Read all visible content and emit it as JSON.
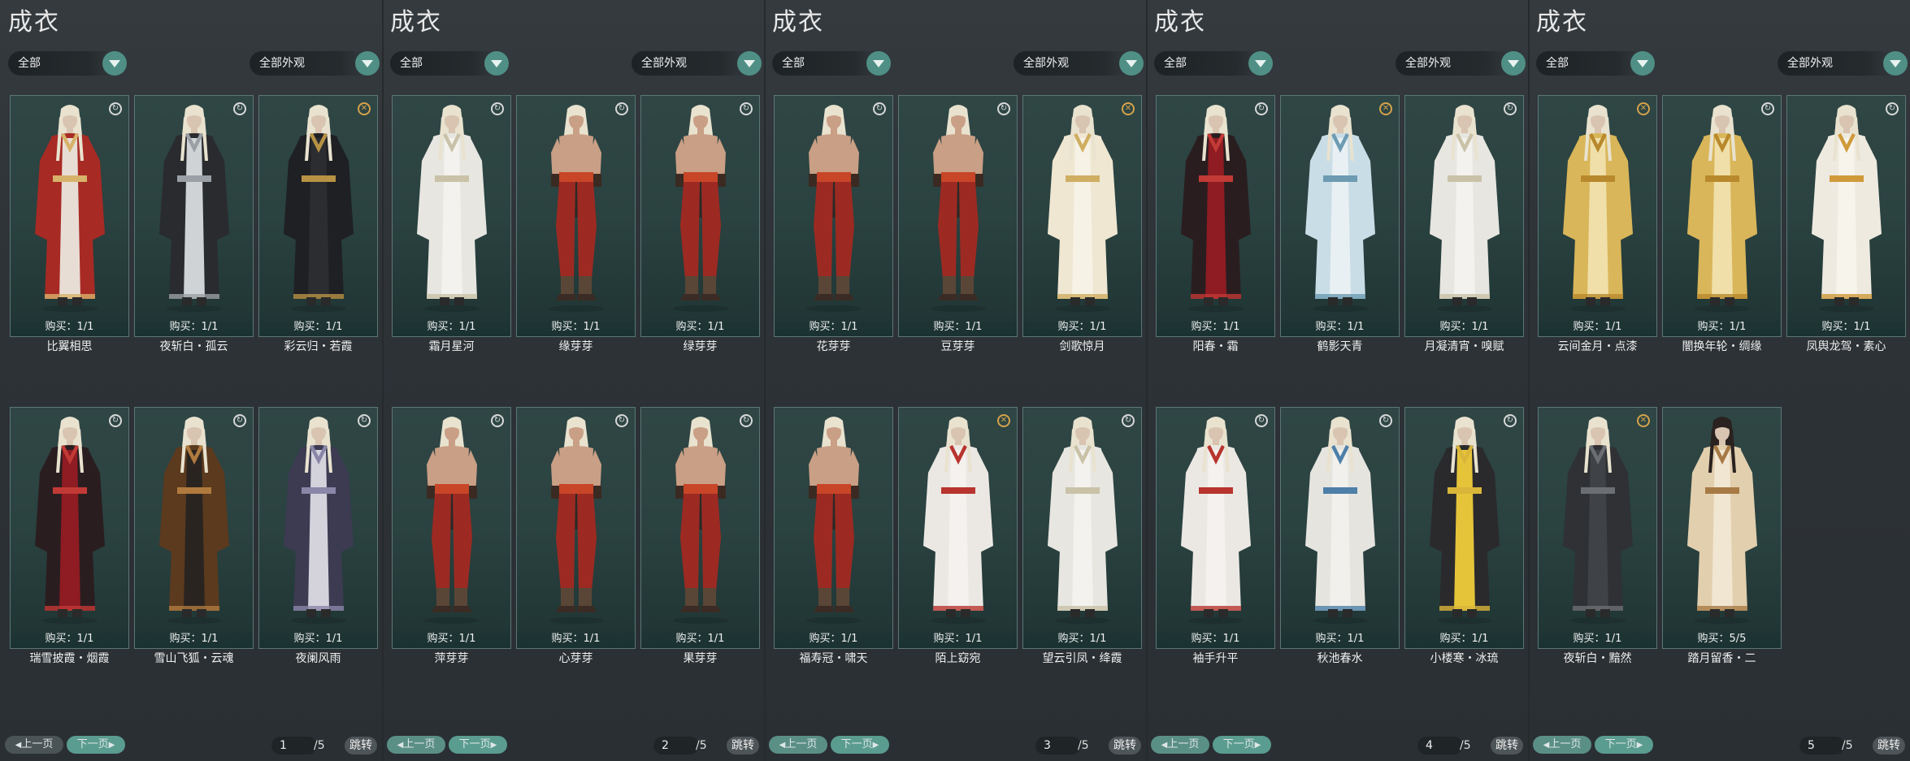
{
  "colors": {
    "accent": "#4f8f86",
    "card_bg": "#2b4341",
    "panel_bg": "#2f3438"
  },
  "panels": [
    {
      "title": "成衣",
      "filter_category": "全部",
      "filter_appearance": "全部外观",
      "cards": [
        {
          "name": "比翼相思",
          "buy": "购买：1/1",
          "badge": "outfit-icon",
          "palette": "red"
        },
        {
          "name": "夜斩白・孤云",
          "buy": "购买：1/1",
          "badge": "outfit-icon",
          "palette": "silverblack"
        },
        {
          "name": "彩云归・若霞",
          "buy": "购买：1/1",
          "badge": "trash-icon",
          "palette": "blackgold"
        },
        {
          "name": "瑞雪披霞・烟霞",
          "buy": "购买：1/1",
          "badge": "outfit-icon",
          "palette": "blackred"
        },
        {
          "name": "雪山飞狐・云魂",
          "buy": "购买：1/1",
          "badge": "outfit-icon",
          "palette": "brown"
        },
        {
          "name": "夜阑风雨",
          "buy": "购买：1/1",
          "badge": "outfit-icon",
          "palette": "purple"
        }
      ],
      "prev_label": "上一页",
      "next_label": "下一页",
      "page": "1",
      "total": "/5",
      "jump_label": "跳转"
    },
    {
      "title": "成衣",
      "filter_category": "全部",
      "filter_appearance": "全部外观",
      "cards": [
        {
          "name": "霜月星河",
          "buy": "购买：1/1",
          "badge": "outfit-icon",
          "palette": "white"
        },
        {
          "name": "缘芽芽",
          "buy": "购买：1/1",
          "badge": "outfit-icon",
          "palette": "bare"
        },
        {
          "name": "绿芽芽",
          "buy": "购买：1/1",
          "badge": "outfit-icon",
          "palette": "bare"
        },
        {
          "name": "萍芽芽",
          "buy": "购买：1/1",
          "badge": "outfit-icon",
          "palette": "bare"
        },
        {
          "name": "心芽芽",
          "buy": "购买：1/1",
          "badge": "outfit-icon",
          "palette": "bare"
        },
        {
          "name": "果芽芽",
          "buy": "购买：1/1",
          "badge": "outfit-icon",
          "palette": "bare"
        }
      ],
      "prev_label": "上一页",
      "next_label": "下一页",
      "page": "2",
      "total": "/5",
      "jump_label": "跳转"
    },
    {
      "title": "成衣",
      "filter_category": "全部",
      "filter_appearance": "全部外观",
      "cards": [
        {
          "name": "花芽芽",
          "buy": "购买：1/1",
          "badge": "outfit-icon",
          "palette": "bare"
        },
        {
          "name": "豆芽芽",
          "buy": "购买：1/1",
          "badge": "outfit-icon",
          "palette": "bare"
        },
        {
          "name": "剑歌惊月",
          "buy": "购买：1/1",
          "badge": "trash-icon",
          "palette": "cream"
        },
        {
          "name": "福寿冠・啸天",
          "buy": "购买：1/1",
          "badge": "none",
          "palette": "bare"
        },
        {
          "name": "陌上窈宛",
          "buy": "购买：1/1",
          "badge": "trash-icon",
          "palette": "whitered"
        },
        {
          "name": "望云引凤・绛霞",
          "buy": "购买：1/1",
          "badge": "outfit-icon",
          "palette": "white"
        }
      ],
      "prev_label": "上一页",
      "next_label": "下一页",
      "page": "3",
      "total": "/5",
      "jump_label": "跳转"
    },
    {
      "title": "成衣",
      "filter_category": "全部",
      "filter_appearance": "全部外观",
      "cards": [
        {
          "name": "阳春・霜",
          "buy": "购买：1/1",
          "badge": "outfit-icon",
          "palette": "blackred"
        },
        {
          "name": "鹤影天青",
          "buy": "购买：1/1",
          "badge": "trash-icon",
          "palette": "paleblue"
        },
        {
          "name": "月凝清宵・嗅赋",
          "buy": "购买：1/1",
          "badge": "outfit-icon",
          "palette": "white"
        },
        {
          "name": "袖手升平",
          "buy": "购买：1/1",
          "badge": "outfit-icon",
          "palette": "whitered"
        },
        {
          "name": "秋池春水",
          "buy": "购买：1/1",
          "badge": "outfit-icon",
          "palette": "whiteblue"
        },
        {
          "name": "小楼寒・冰琉",
          "buy": "购买：1/1",
          "badge": "outfit-icon",
          "palette": "yellowblack"
        }
      ],
      "prev_label": "上一页",
      "next_label": "下一页",
      "page": "4",
      "total": "/5",
      "jump_label": "跳转"
    },
    {
      "title": "成衣",
      "filter_category": "全部",
      "filter_appearance": "全部外观",
      "cards": [
        {
          "name": "云间金月・点漆",
          "buy": "购买：1/1",
          "badge": "trash-icon",
          "palette": "gold"
        },
        {
          "name": "闇换年轮・绸缘",
          "buy": "购买：1/1",
          "badge": "outfit-icon",
          "palette": "gold"
        },
        {
          "name": "凤舆龙驾・素心",
          "buy": "购买：1/1",
          "badge": "outfit-icon",
          "palette": "whitegold"
        },
        {
          "name": "夜斩白・黯然",
          "buy": "购买：1/1",
          "badge": "trash-icon",
          "palette": "darkgray"
        },
        {
          "name": "踏月留香・二",
          "buy": "购买：5/5",
          "badge": "none",
          "palette": "beige"
        }
      ],
      "prev_label": "上一页",
      "next_label": "下一页",
      "page": "5",
      "total": "/5",
      "jump_label": "跳转"
    }
  ]
}
